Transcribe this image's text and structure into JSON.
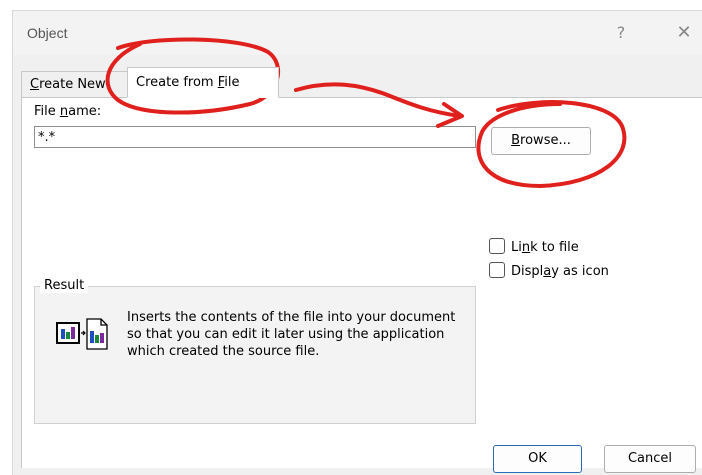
{
  "window": {
    "title": "Object",
    "help_glyph": "?",
    "close_glyph": "✕"
  },
  "tabs": [
    {
      "label": "Create New",
      "selected": false
    },
    {
      "label": "Create from File",
      "selected": true
    }
  ],
  "file": {
    "label": "File name:",
    "value": "*.*",
    "browse_label": "Browse..."
  },
  "options": {
    "link_label": "Link to file",
    "icon_label": "Display as icon"
  },
  "result": {
    "legend": "Result",
    "text": "Inserts the contents of the file into your document so that you can edit it later using the application which created the source file."
  },
  "buttons": {
    "ok": "OK",
    "cancel": "Cancel"
  },
  "annotation": {
    "color": "#e0201c"
  }
}
